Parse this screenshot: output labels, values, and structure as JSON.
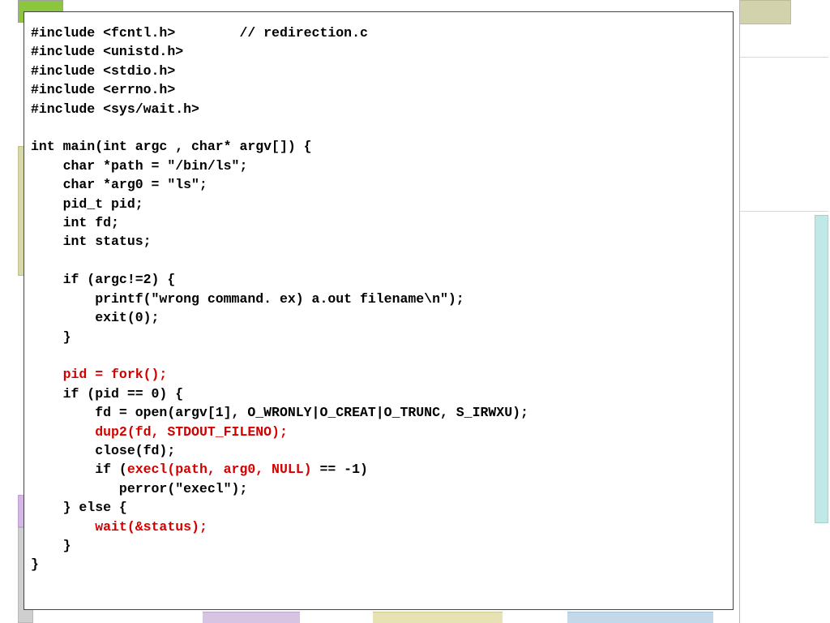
{
  "code": {
    "lines": [
      {
        "segments": [
          {
            "t": "#include <fcntl.h>        // redirection.c"
          }
        ]
      },
      {
        "segments": [
          {
            "t": "#include <unistd.h>"
          }
        ]
      },
      {
        "segments": [
          {
            "t": "#include <stdio.h>"
          }
        ]
      },
      {
        "segments": [
          {
            "t": "#include <errno.h>"
          }
        ]
      },
      {
        "segments": [
          {
            "t": "#include <sys/wait.h>"
          }
        ]
      },
      {
        "segments": [
          {
            "t": ""
          }
        ]
      },
      {
        "segments": [
          {
            "t": "int main(int argc , char* argv[]) {"
          }
        ]
      },
      {
        "segments": [
          {
            "t": "    char *path = \"/bin/ls\";"
          }
        ]
      },
      {
        "segments": [
          {
            "t": "    char *arg0 = \"ls\";"
          }
        ]
      },
      {
        "segments": [
          {
            "t": "    pid_t pid;"
          }
        ]
      },
      {
        "segments": [
          {
            "t": "    int fd;"
          }
        ]
      },
      {
        "segments": [
          {
            "t": "    int status;"
          }
        ]
      },
      {
        "segments": [
          {
            "t": ""
          }
        ]
      },
      {
        "segments": [
          {
            "t": "    if (argc!=2) {"
          }
        ]
      },
      {
        "segments": [
          {
            "t": "        printf(\"wrong command. ex) a.out filename\\n\");"
          }
        ]
      },
      {
        "segments": [
          {
            "t": "        exit(0);"
          }
        ]
      },
      {
        "segments": [
          {
            "t": "    }"
          }
        ]
      },
      {
        "segments": [
          {
            "t": ""
          }
        ]
      },
      {
        "segments": [
          {
            "t": "    "
          },
          {
            "t": "pid = fork();",
            "hl": true
          }
        ]
      },
      {
        "segments": [
          {
            "t": "    if (pid == 0) {"
          }
        ]
      },
      {
        "segments": [
          {
            "t": "        fd = open(argv[1], O_WRONLY|O_CREAT|O_TRUNC, S_IRWXU);"
          }
        ]
      },
      {
        "segments": [
          {
            "t": "        "
          },
          {
            "t": "dup2(fd, STDOUT_FILENO);",
            "hl": true
          }
        ]
      },
      {
        "segments": [
          {
            "t": "        close(fd);"
          }
        ]
      },
      {
        "segments": [
          {
            "t": "        if ("
          },
          {
            "t": "execl(path, arg0, NULL)",
            "hl": true
          },
          {
            "t": " == -1)"
          }
        ]
      },
      {
        "segments": [
          {
            "t": "           perror(\"execl\");"
          }
        ]
      },
      {
        "segments": [
          {
            "t": "    } else {"
          }
        ]
      },
      {
        "segments": [
          {
            "t": "        "
          },
          {
            "t": "wait(&status);",
            "hl": true
          }
        ]
      },
      {
        "segments": [
          {
            "t": "    }"
          }
        ]
      },
      {
        "segments": [
          {
            "t": "}"
          }
        ]
      }
    ]
  }
}
